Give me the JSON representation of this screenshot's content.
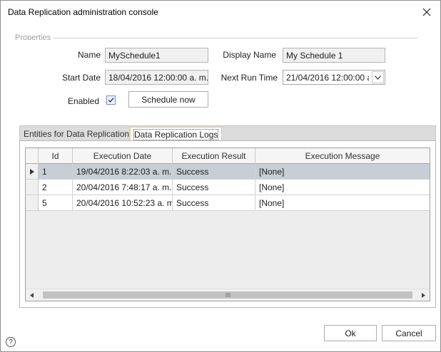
{
  "window": {
    "title": "Data Replication administration console"
  },
  "properties": {
    "group_label": "Properties",
    "name_label": "Name",
    "name_value": "MySchedule1",
    "display_name_label": "Display Name",
    "display_name_value": "My Schedule 1",
    "start_date_label": "Start Date",
    "start_date_value": "18/04/2016 12:00:00 a. m.",
    "next_run_label": "Next Run Time",
    "next_run_value": "21/04/2016 12:00:00 a.",
    "enabled_label": "Enabled",
    "enabled_checked": true,
    "schedule_now_label": "Schedule now"
  },
  "tabs": [
    {
      "label": "Entities for Data Replication",
      "active": false
    },
    {
      "label": "Data Replication Logs",
      "active": true
    }
  ],
  "grid": {
    "columns": [
      "Id",
      "Execution Date",
      "Execution Result",
      "Execution Message"
    ],
    "rows": [
      {
        "id": "1",
        "date": "19/04/2016 8:22:03 a. m.",
        "result": "Success",
        "message": "[None]",
        "selected": true
      },
      {
        "id": "2",
        "date": "20/04/2016 7:48:17 a. m.",
        "result": "Success",
        "message": "[None]",
        "selected": false
      },
      {
        "id": "5",
        "date": "20/04/2016 10:52:23 a. m.",
        "result": "Success",
        "message": "[None]",
        "selected": false
      }
    ]
  },
  "footer": {
    "ok_label": "Ok",
    "cancel_label": "Cancel",
    "help_glyph": "?"
  },
  "icons": {
    "close": "close-icon",
    "dropdown": "chevron-down-icon",
    "row_indicator": "current-row-icon",
    "scroll_left": "scroll-left-icon",
    "scroll_right": "scroll-right-icon",
    "help": "help-icon"
  }
}
